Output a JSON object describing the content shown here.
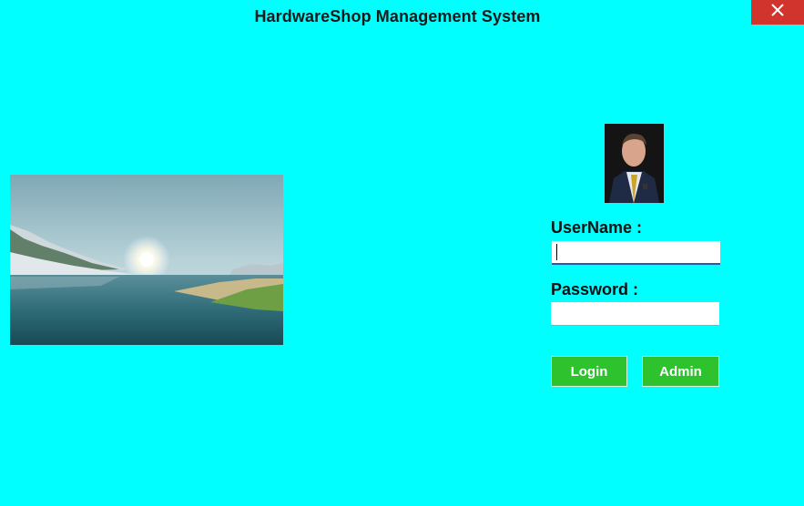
{
  "window": {
    "title": "HardwareShop Management System",
    "close_icon": "close-icon",
    "background_color": "#00FFFF",
    "close_color": "#D0342C"
  },
  "images": {
    "landscape": "lake-landscape-image",
    "avatar": "user-avatar-photo"
  },
  "form": {
    "username_label": "UserName :",
    "username_value": "",
    "password_label": "Password :",
    "password_value": "",
    "login_label": "Login",
    "admin_label": "Admin",
    "button_color": "#2EC22E"
  }
}
